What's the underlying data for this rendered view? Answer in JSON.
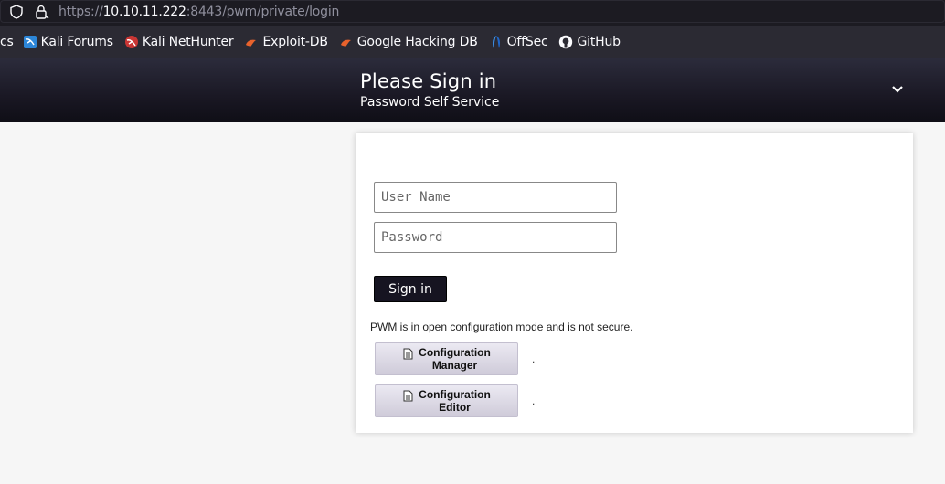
{
  "browser": {
    "url_prefix": "https://",
    "url_host": "10.10.11.222",
    "url_suffix": ":8443/pwm/private/login",
    "bookmarks": [
      {
        "label": "cs",
        "icon": "none"
      },
      {
        "label": "Kali Forums",
        "icon": "kali-forums-icon"
      },
      {
        "label": "Kali NetHunter",
        "icon": "kali-nethunter-icon"
      },
      {
        "label": "Exploit-DB",
        "icon": "exploit-db-icon"
      },
      {
        "label": "Google Hacking DB",
        "icon": "ghdb-icon"
      },
      {
        "label": "OffSec",
        "icon": "offsec-icon"
      },
      {
        "label": "GitHub",
        "icon": "github-icon"
      }
    ]
  },
  "header": {
    "title": "Please Sign in",
    "subtitle": "Password Self Service"
  },
  "form": {
    "username_placeholder": "User Name",
    "username_value": "",
    "password_placeholder": "Password",
    "password_value": "",
    "signin_label": "Sign in"
  },
  "config": {
    "notice": "PWM is in open configuration mode and is not secure.",
    "manager_line1": "Configuration",
    "manager_line2": "Manager",
    "editor_line1": "Configuration",
    "editor_line2": "Editor",
    "separator": "."
  },
  "colors": {
    "header_dark": "#1a1824",
    "signin_button": "#161421",
    "config_button": "#d6d2e0"
  }
}
